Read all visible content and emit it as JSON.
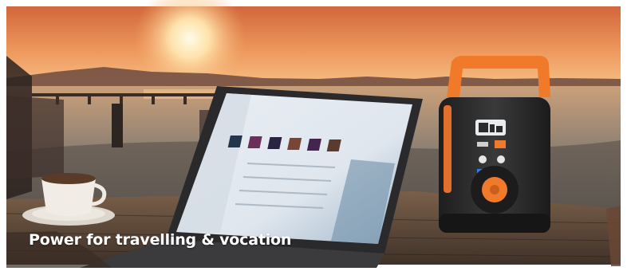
{
  "banner": {
    "caption": "Power for travelling & vocation",
    "colors": {
      "sky_top": "#d9774a",
      "sky_horizon": "#f7c48a",
      "sun": "#fff4d6",
      "sea": "#8a7f74",
      "table_wood": "#5e4a3c",
      "station_body": "#2b2b2b",
      "station_accent": "#f07a2a"
    },
    "scene_items": [
      "sunset-sky",
      "sea",
      "pier",
      "laptop",
      "coffee-cup",
      "portable-power-station"
    ]
  }
}
